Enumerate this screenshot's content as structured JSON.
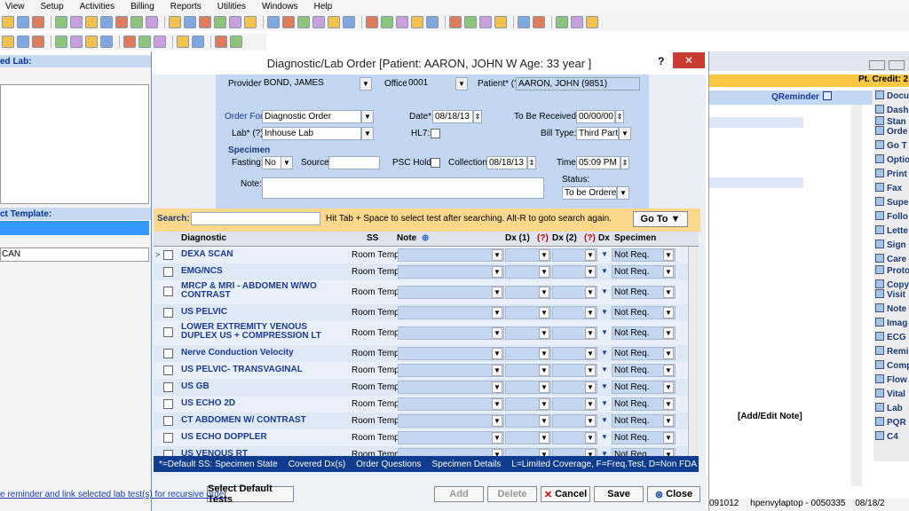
{
  "menu": [
    "View",
    "Setup",
    "Activities",
    "Billing",
    "Reports",
    "Utilities",
    "Windows",
    "Help"
  ],
  "left": {
    "lab_label": "ed Lab:",
    "template_label": "ct Template:",
    "template_item": "CAN"
  },
  "dialog": {
    "title": "Diagnostic/Lab Order  [Patient: AARON, JOHN W  Age: 33 year ]",
    "help": "?",
    "close": "✕",
    "provider_label": "Provider*",
    "provider": "BOND, JAMES",
    "office_label": "Office",
    "office": "0001",
    "patient_label": "Patient* (?)",
    "patient": "AARON, JOHN  (9851)",
    "orderfor_label": "Order For*",
    "orderfor": "Diagnostic Order",
    "date_label": "Date*",
    "date": "08/18/13",
    "toberecv_label": "To Be Received:",
    "toberecv": "00/00/00",
    "lab_label": "Lab* (?)",
    "lab": "Inhouse Lab",
    "hl7_label": "HL7:",
    "billtype_label": "Bill Type:",
    "billtype": "Third Party",
    "specimen_label": "Specimen",
    "fasting_label": "Fasting:",
    "fasting": "No",
    "source_label": "Source:",
    "pschold_label": "PSC Hold:",
    "collection_label": "Collection:",
    "collection": "08/18/13",
    "time_label": "Time:",
    "time": "05:09 PM",
    "note_label": "Note:",
    "status_label": "Status:",
    "status": "To be Ordered",
    "search_label": "Search:",
    "search_hint": "Hit Tab + Space to select test after searching. Alt-R to goto search again.",
    "goto": "Go To",
    "columns": {
      "diag": "Diagnostic",
      "ss": "SS",
      "note": "Note",
      "dx1": "Dx (1)",
      "dx2": "Dx (2)",
      "dx": "Dx",
      "spec": "Specimen",
      "q": "(?)"
    },
    "rows": [
      {
        "name": "DEXA SCAN",
        "ss": "Room Temp.",
        "spec": "Not Req."
      },
      {
        "name": "EMG/NCS",
        "ss": "Room Temp.",
        "spec": "Not Req."
      },
      {
        "name": "MRCP & MRI - ABDOMEN W/WO",
        "name2": "CONTRAST",
        "ss": "Room Temp.",
        "spec": "Not Req."
      },
      {
        "name": "US PELVIC",
        "ss": "Room Temp.",
        "spec": "Not Req."
      },
      {
        "name": "LOWER EXTREMITY VENOUS",
        "name2": "DUPLEX US + COMPRESSION LT",
        "ss": "Room Temp.",
        "spec": "Not Req."
      },
      {
        "name": "Nerve Conduction Velocity",
        "ss": "Room Temp.",
        "spec": "Not Req."
      },
      {
        "name": "US PELVIC- TRANSVAGINAL",
        "ss": "Room Temp.",
        "spec": "Not Req."
      },
      {
        "name": "US GB",
        "ss": "Room Temp.",
        "spec": "Not Req."
      },
      {
        "name": "US ECHO 2D",
        "ss": "Room Temp.",
        "spec": "Not Req."
      },
      {
        "name": "CT ABDOMEN W/ CONTRAST",
        "ss": "Room Temp.",
        "spec": "Not Req."
      },
      {
        "name": "US ECHO DOPPLER",
        "ss": "Room Temp.",
        "spec": "Not Req."
      },
      {
        "name": "US VENOUS RT",
        "ss": "Room Temp.",
        "spec": "Not Req."
      }
    ],
    "legend": [
      "*=Default  SS: Specimen State",
      "Covered Dx(s)",
      "Order Questions",
      "Specimen Details",
      "L=Limited Coverage, F=Freq.Test, D=Non FDA"
    ],
    "recursive_link": "e reminder and link selected lab test(s) for recursive order",
    "select_default": "Select Default Tests",
    "add": "Add",
    "delete": "Delete",
    "cancel": "Cancel",
    "save": "Save",
    "closebtn": "Close"
  },
  "right": {
    "credit": "Pt. Credit: 2",
    "qreminder": "QReminder",
    "addedit": "[Add/Edit Note]",
    "items": [
      "Docu",
      "Dash",
      "Stan",
      "Orde",
      "Go T",
      "Optio",
      "Print",
      "Fax",
      "Supe",
      "Follo",
      "Lette",
      "Sign",
      "Care",
      "Proto",
      "Copy",
      "Visit",
      "Note",
      "Imag",
      "ECG",
      "Remi",
      "Comp",
      "Flow",
      "Vital",
      "Lab",
      "PQR",
      "C4"
    ],
    "status1": "091012",
    "status2": "hpenvylaptop - 0050335",
    "status3": "08/18/2"
  }
}
